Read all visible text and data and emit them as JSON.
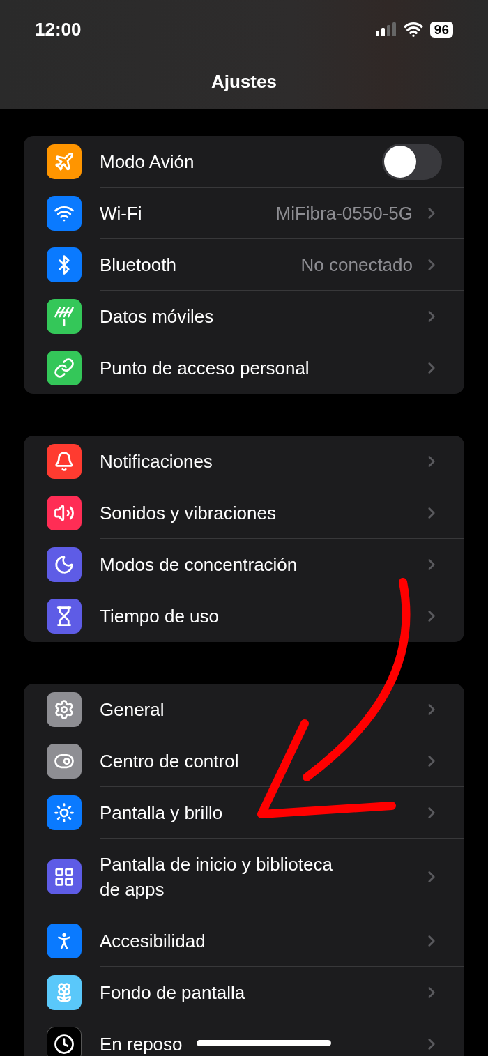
{
  "status_bar": {
    "time": "12:00",
    "battery": "96"
  },
  "title": "Ajustes",
  "groups": [
    {
      "rows": [
        {
          "label": "Modo Avión",
          "kind": "toggle",
          "on": false,
          "color": "#ff9500"
        },
        {
          "label": "Wi-Fi",
          "kind": "value",
          "value": "MiFibra-0550-5G",
          "color": "#0a7aff"
        },
        {
          "label": "Bluetooth",
          "kind": "value",
          "value": "No conectado",
          "color": "#0a7aff"
        },
        {
          "label": "Datos móviles",
          "kind": "plain",
          "color": "#34c759"
        },
        {
          "label": "Punto de acceso personal",
          "kind": "plain",
          "color": "#34c759"
        }
      ]
    },
    {
      "rows": [
        {
          "label": "Notificaciones",
          "kind": "plain",
          "color": "#ff3b30"
        },
        {
          "label": "Sonidos y vibraciones",
          "kind": "plain",
          "color": "#ff2d55"
        },
        {
          "label": "Modos de concentración",
          "kind": "plain",
          "color": "#5e5ce6"
        },
        {
          "label": "Tiempo de uso",
          "kind": "plain",
          "color": "#5e5ce6"
        }
      ]
    },
    {
      "rows": [
        {
          "label": "General",
          "kind": "plain",
          "color": "#8e8e93"
        },
        {
          "label": "Centro de control",
          "kind": "plain",
          "color": "#8e8e93"
        },
        {
          "label": "Pantalla y brillo",
          "kind": "plain",
          "color": "#0a7aff"
        },
        {
          "label": "Pantalla de inicio y biblioteca de apps",
          "kind": "plain",
          "color": "#5e5ce6"
        },
        {
          "label": "Accesibilidad",
          "kind": "plain",
          "color": "#0a7aff"
        },
        {
          "label": "Fondo de pantalla",
          "kind": "plain",
          "color": "#5ac8fa"
        },
        {
          "label": "En reposo",
          "kind": "plain",
          "color": "#000000"
        }
      ]
    }
  ]
}
